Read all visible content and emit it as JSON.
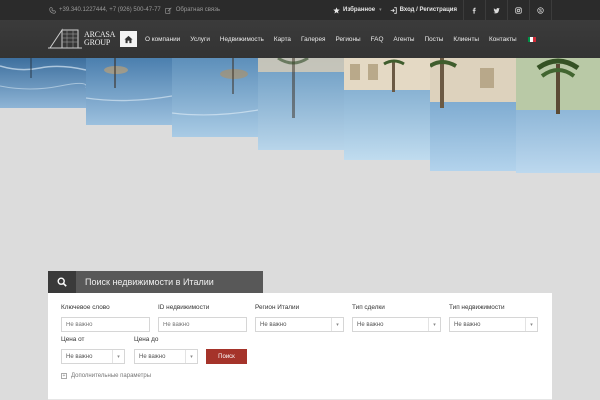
{
  "topbar": {
    "phone": "+39.340.1227444, +7 (926) 500-47-77",
    "feedback": "Обратная связь",
    "favorites": "Избранное",
    "login": "Вход / Регистрация",
    "social": [
      "facebook-icon",
      "twitter-icon",
      "instagram-icon",
      "skype-icon"
    ]
  },
  "logo": {
    "line1": "ARCASA",
    "line2": "GROUP"
  },
  "nav": {
    "items": [
      "О компании",
      "Услуги",
      "Недвижимость",
      "Карта",
      "Галерея",
      "Регионы",
      "FAQ",
      "Агенты",
      "Посты",
      "Клиенты",
      "Контакты"
    ],
    "flag_colors": [
      "#009246",
      "#ffffff",
      "#ce2b37"
    ]
  },
  "search": {
    "title": "Поиск недвижимости в Италии",
    "keyword_label": "Ключевое слово",
    "keyword_placeholder": "Не важно",
    "id_label": "ID недвижимости",
    "id_placeholder": "Не важно",
    "region_label": "Регион Италии",
    "region_value": "Не важно",
    "deal_label": "Тип сделки",
    "deal_value": "Не важно",
    "property_label": "Тип недвижимости",
    "property_value": "Не важно",
    "price_from_label": "Цена от",
    "price_from_value": "Не важно",
    "price_to_label": "Цена до",
    "price_to_value": "Не важно",
    "button": "Поиск",
    "more": "Дополнительные параметры"
  },
  "colors": {
    "accent": "#a5332a",
    "dark": "#2b2b2b"
  }
}
